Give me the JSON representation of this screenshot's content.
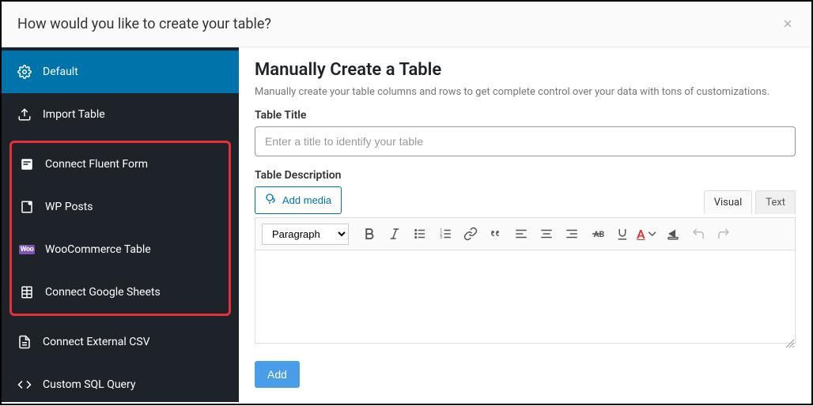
{
  "modal": {
    "title": "How would you like to create your table?"
  },
  "sidebar": {
    "items": [
      {
        "label": "Default"
      },
      {
        "label": "Import Table"
      },
      {
        "label": "Connect Fluent Form"
      },
      {
        "label": "WP Posts"
      },
      {
        "label": "WooCommerce Table"
      },
      {
        "label": "Connect Google Sheets"
      },
      {
        "label": "Connect External CSV"
      },
      {
        "label": "Custom SQL Query"
      }
    ]
  },
  "main": {
    "heading": "Manually Create a Table",
    "description": "Manually create your table columns and rows to get complete control over your data with tons of customizations.",
    "title_label": "Table Title",
    "title_placeholder": "Enter a title to identify your table",
    "desc_label": "Table Description",
    "add_media_label": "Add media",
    "tabs": {
      "visual": "Visual",
      "text": "Text"
    },
    "format_select": "Paragraph",
    "add_button": "Add"
  }
}
